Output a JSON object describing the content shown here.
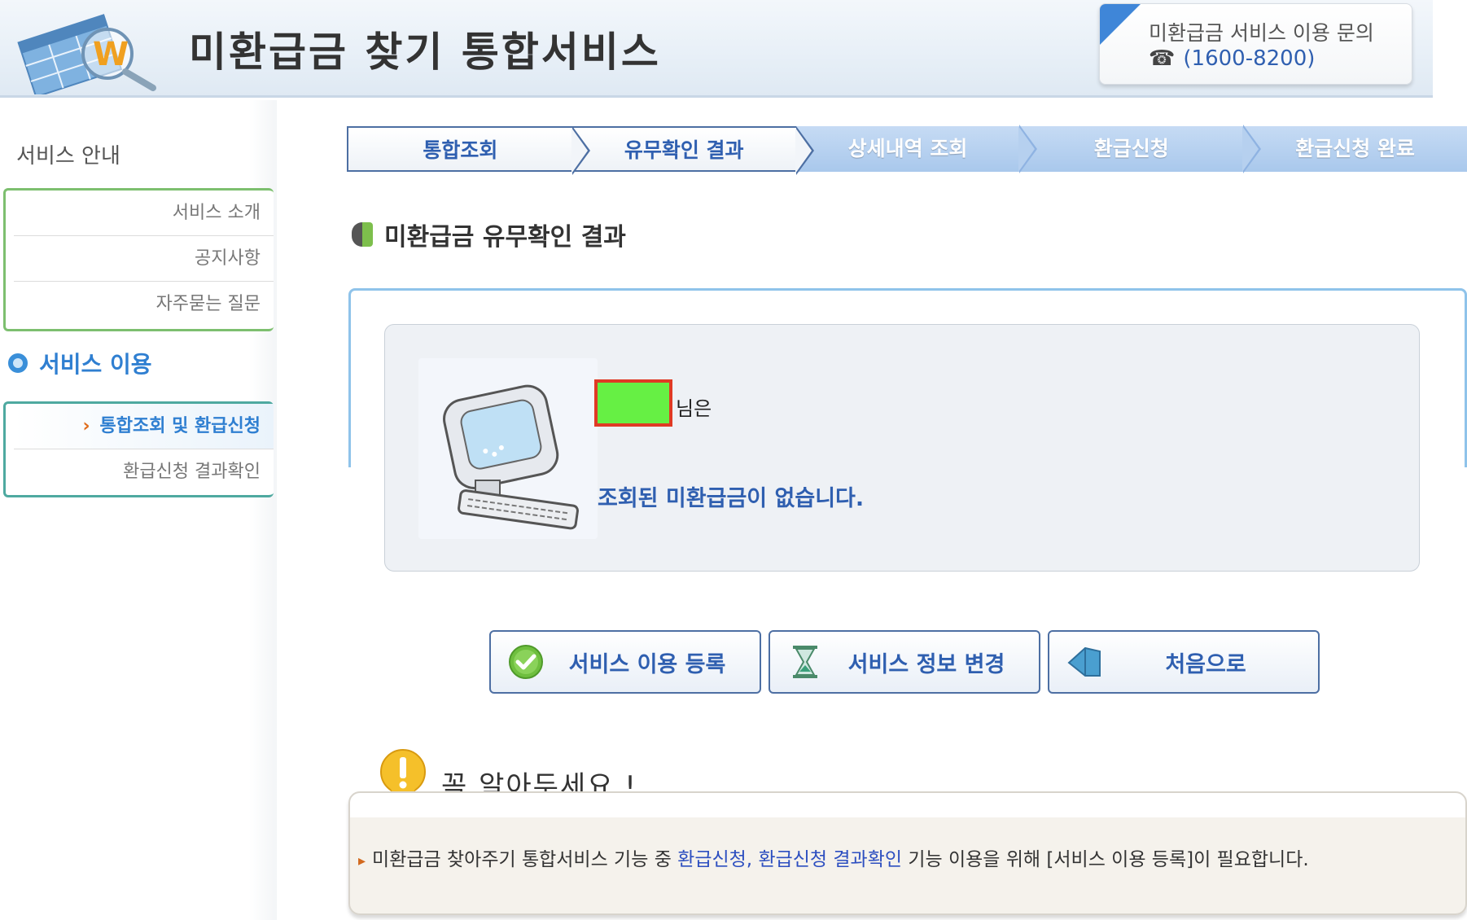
{
  "header": {
    "title": "미환급금 찾기 통합서비스",
    "contact_title": "미환급금 서비스 이용 문의",
    "contact_phone": "(1600-8200)"
  },
  "sidebar": {
    "group1_title": "서비스 안내",
    "group1_items": [
      "서비스 소개",
      "공지사항",
      "자주묻는 질문"
    ],
    "group2_title": "서비스 이용",
    "group2_items": [
      "통합조회 및 환급신청",
      "환급신청 결과확인"
    ],
    "active_item": "통합조회 및 환급신청"
  },
  "steps": [
    "통합조회",
    "유무확인 결과",
    "상세내역 조회",
    "환급신청",
    "환급신청 완료"
  ],
  "section": {
    "title": "미환급금 유무확인 결과"
  },
  "result": {
    "name_suffix": "님은",
    "message": "조회된 미환급금이 없습니다."
  },
  "buttons": {
    "register": "서비스 이용 등록",
    "change": "서비스 정보 변경",
    "home": "처음으로"
  },
  "notice": {
    "title": "꼭 알아두세요 !",
    "text_before": "미환급금 찾아주기 통합서비스 기능 중 ",
    "link1": "환급신청, ",
    "link2": "환급신청 결과확인",
    "text_after": " 기능 이용을 위해 [서비스 이용 등록]이 필요합니다."
  },
  "colors": {
    "accent_blue": "#2f5fb0",
    "sidebar_green": "#7dbf6f",
    "redacted_fill": "#66f044",
    "redacted_border": "#e03a24"
  },
  "icons": {
    "logo": "document-magnifier-w-logo",
    "phone": "telephone-icon",
    "register": "check-circle-icon",
    "change": "hourglass-icon",
    "home": "back-arrow-icon"
  }
}
